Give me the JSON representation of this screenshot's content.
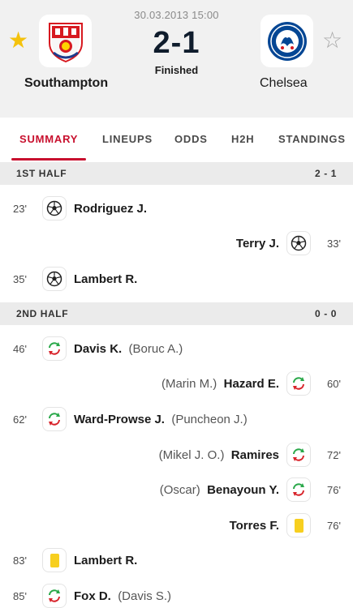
{
  "match": {
    "datetime": "30.03.2013 15:00",
    "score": "2-1",
    "status": "Finished",
    "home_team": "Southampton",
    "away_team": "Chelsea"
  },
  "tabs": [
    {
      "label": "SUMMARY",
      "active": true
    },
    {
      "label": "LINEUPS",
      "active": false
    },
    {
      "label": "ODDS",
      "active": false
    },
    {
      "label": "H2H",
      "active": false
    },
    {
      "label": "STANDINGS",
      "active": false
    }
  ],
  "sections": {
    "first_half": {
      "label": "1ST HALF",
      "score": "2 - 1"
    },
    "second_half": {
      "label": "2ND HALF",
      "score": "0 - 0"
    }
  },
  "events": [
    {
      "minute": "23'",
      "side": "home",
      "type": "goal",
      "player": "Rodriguez J.",
      "assist": ""
    },
    {
      "minute": "33'",
      "side": "away",
      "type": "goal",
      "player": "Terry J.",
      "assist": ""
    },
    {
      "minute": "35'",
      "side": "home",
      "type": "goal",
      "player": "Lambert R.",
      "assist": ""
    },
    {
      "minute": "46'",
      "side": "home",
      "type": "substitution",
      "player": "Davis K.",
      "assist": "(Boruc A.)"
    },
    {
      "minute": "60'",
      "side": "away",
      "type": "substitution",
      "player": "Hazard E.",
      "assist": "(Marin M.)"
    },
    {
      "minute": "62'",
      "side": "home",
      "type": "substitution",
      "player": "Ward-Prowse J.",
      "assist": "(Puncheon J.)"
    },
    {
      "minute": "72'",
      "side": "away",
      "type": "substitution",
      "player": "Ramires",
      "assist": "(Mikel J. O.)"
    },
    {
      "minute": "76'",
      "side": "away",
      "type": "substitution",
      "player": "Benayoun Y.",
      "assist": "(Oscar)"
    },
    {
      "minute": "76'",
      "side": "away",
      "type": "yellow-card",
      "player": "Torres F.",
      "assist": ""
    },
    {
      "minute": "83'",
      "side": "home",
      "type": "yellow-card",
      "player": "Lambert R.",
      "assist": ""
    },
    {
      "minute": "85'",
      "side": "home",
      "type": "substitution",
      "player": "Fox D.",
      "assist": "(Davis S.)"
    }
  ],
  "colors": {
    "accent": "#c8102e",
    "yellow_card": "#f7cf1f",
    "sub_in": "#2aa84a",
    "sub_out": "#d8232a",
    "star_active": "#f4c20d",
    "star_inactive": "#a7a7a7"
  }
}
